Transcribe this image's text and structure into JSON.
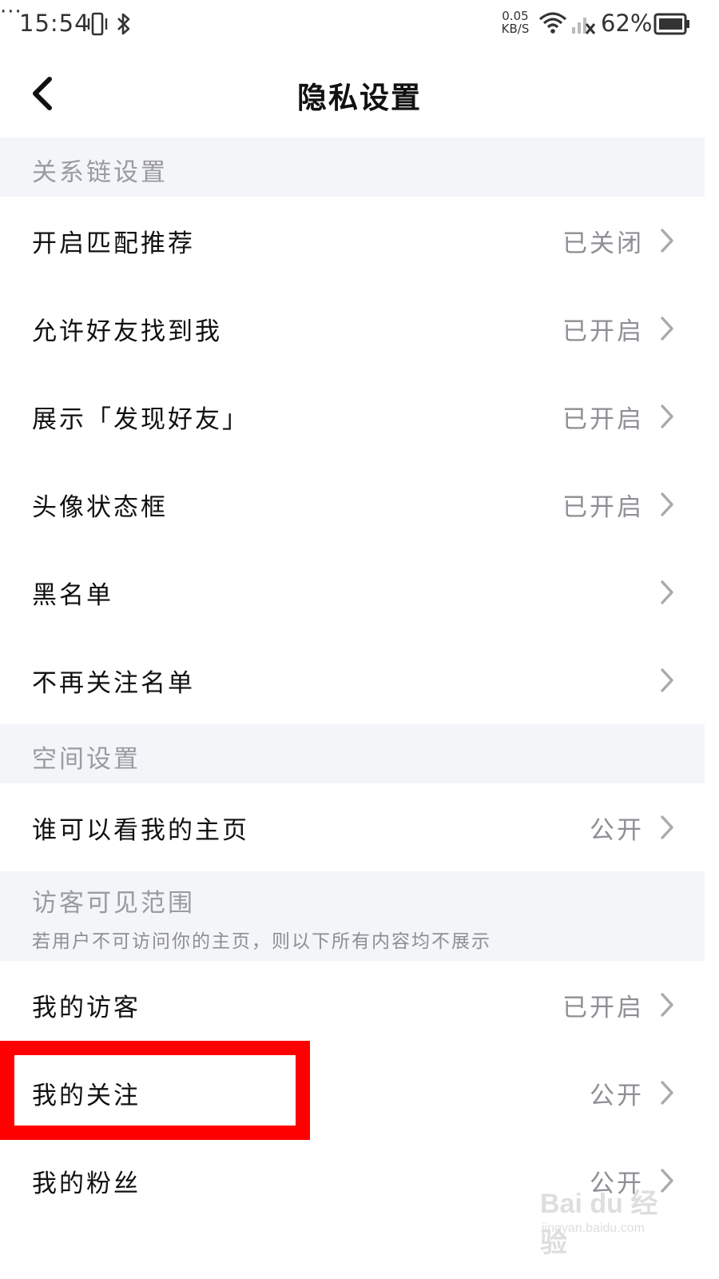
{
  "status_bar": {
    "time": "15:54",
    "more": "···",
    "net_speed_value": "0.05",
    "net_speed_unit": "KB/S",
    "battery_pct": "62%",
    "icons": [
      "vibrate-icon",
      "bluetooth-icon",
      "wifi-icon",
      "signal-icon",
      "battery-icon"
    ]
  },
  "nav": {
    "title": "隐私设置",
    "back_icon": "chevron-left-icon"
  },
  "sections": {
    "relation": {
      "title": "关系链设置",
      "rows": [
        {
          "label": "开启匹配推荐",
          "value": "已关闭"
        },
        {
          "label": "允许好友找到我",
          "value": "已开启"
        },
        {
          "label": "展示「发现好友」",
          "value": "已开启"
        },
        {
          "label": "头像状态框",
          "value": "已开启"
        },
        {
          "label": "黑名单",
          "value": ""
        },
        {
          "label": "不再关注名单",
          "value": ""
        }
      ]
    },
    "space": {
      "title": "空间设置",
      "rows": [
        {
          "label": "谁可以看我的主页",
          "value": "公开"
        }
      ]
    },
    "visitor": {
      "title": "访客可见范围",
      "subtitle": "若用户不可访问你的主页，则以下所有内容均不展示",
      "rows": [
        {
          "label": "我的访客",
          "value": "已开启"
        },
        {
          "label": "我的关注",
          "value": "公开"
        },
        {
          "label": "我的粉丝",
          "value": "公开"
        }
      ]
    }
  },
  "colors": {
    "section_bg": "#f4f5f9",
    "highlight": "#ff0000",
    "value_text": "#8e8f95"
  },
  "watermark": {
    "brand": "Bai du 经验",
    "url": "jingyan.baidu.com"
  }
}
